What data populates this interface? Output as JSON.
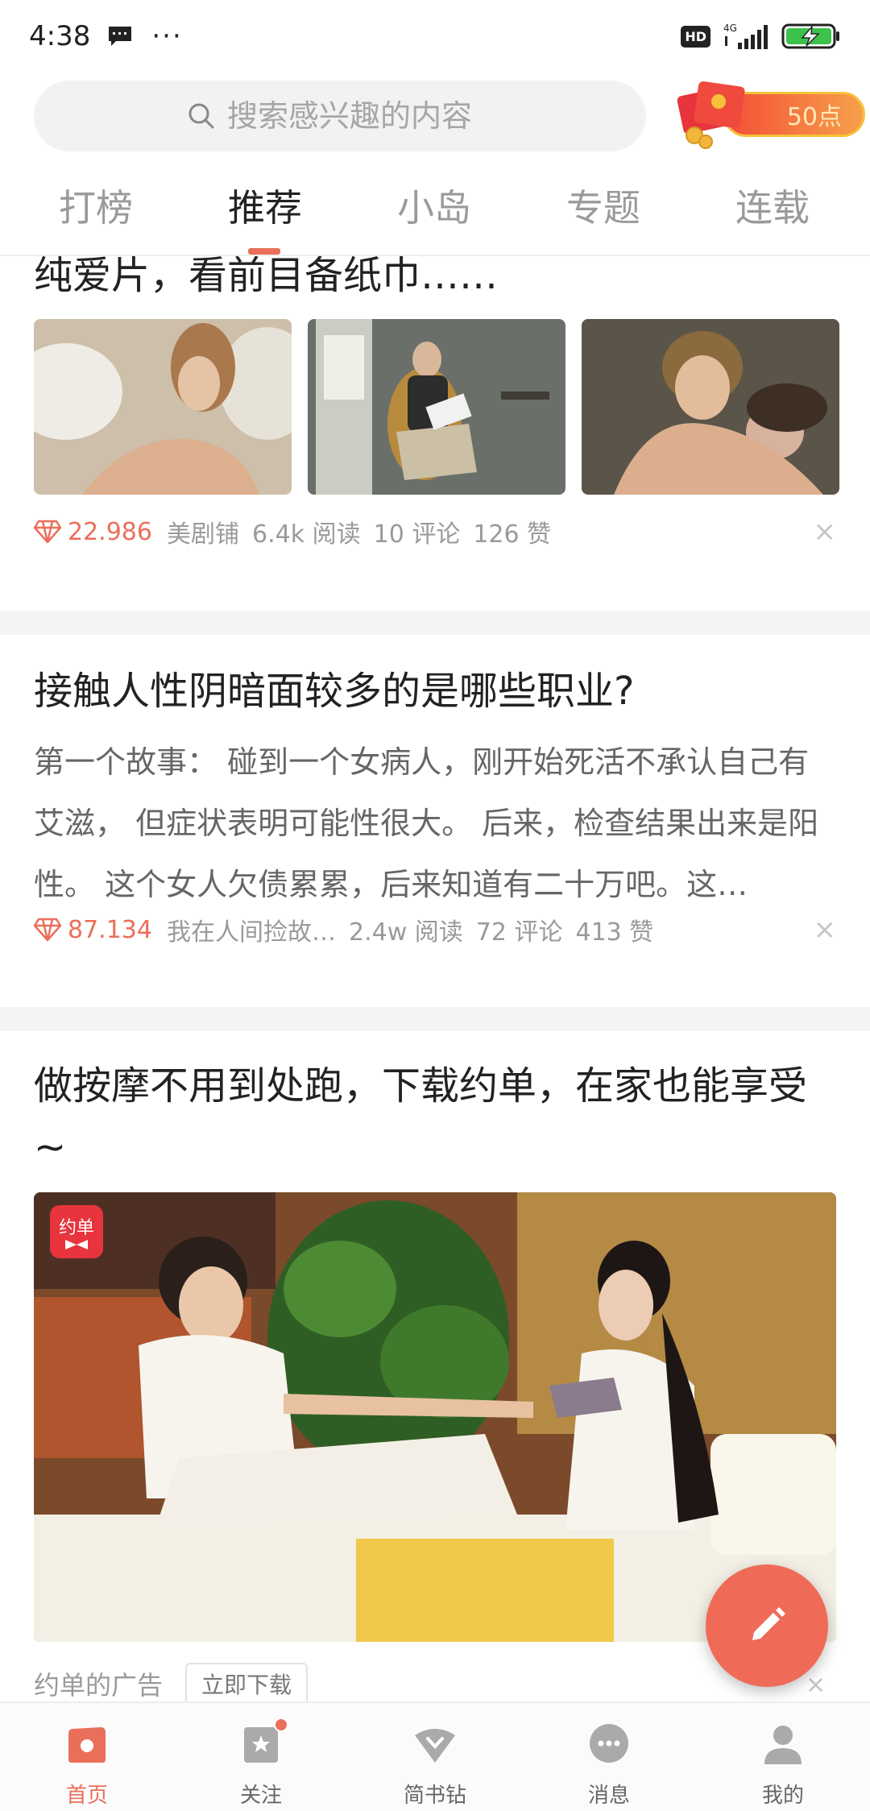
{
  "status": {
    "time": "4:38",
    "dots": "···",
    "hd": "HD",
    "network": "4G"
  },
  "search": {
    "placeholder": "搜索感兴趣的内容",
    "reward_points": "50点"
  },
  "tabs": [
    {
      "label": "打榜"
    },
    {
      "label": "推荐",
      "active": true
    },
    {
      "label": "小岛"
    },
    {
      "label": "专题"
    },
    {
      "label": "连载"
    }
  ],
  "feed": {
    "card1": {
      "title_partial": "纯爱片，看前目备纸巾……",
      "score": "22.986",
      "author": "美剧铺",
      "reads": "6.4k 阅读",
      "comments": "10 评论",
      "likes": "126 赞",
      "dismiss": "×"
    },
    "card2": {
      "title": "接触人性阴暗面较多的是哪些职业?",
      "summary": "第一个故事： 碰到一个女病人，刚开始死活不承认自己有艾滋， 但症状表明可能性很大。 后来，检查结果出来是阳性。 这个女人欠债累累，后来知道有二十万吧。这…",
      "score": "87.134",
      "author": "我在人间捡故…",
      "reads": "2.4w 阅读",
      "comments": "72 评论",
      "likes": "413 赞",
      "dismiss": "×"
    },
    "card3": {
      "title": "做按摩不用到处跑，下载约单，在家也能享受~",
      "ad_logo_text": "约单",
      "ad_source": "约单的广告",
      "download_label": "立即下载",
      "dismiss": "×"
    }
  },
  "bottom_nav": [
    {
      "label": "首页",
      "icon": "home-icon",
      "active": true
    },
    {
      "label": "关注",
      "icon": "follow-icon"
    },
    {
      "label": "简书钻",
      "icon": "diamond-icon"
    },
    {
      "label": "消息",
      "icon": "message-icon"
    },
    {
      "label": "我的",
      "icon": "profile-icon"
    }
  ],
  "colors": {
    "accent": "#ea6f5a",
    "fab": "#ef6b57",
    "reward_gradient_start": "#f44f38",
    "reward_gradient_end": "#f6a04a"
  }
}
